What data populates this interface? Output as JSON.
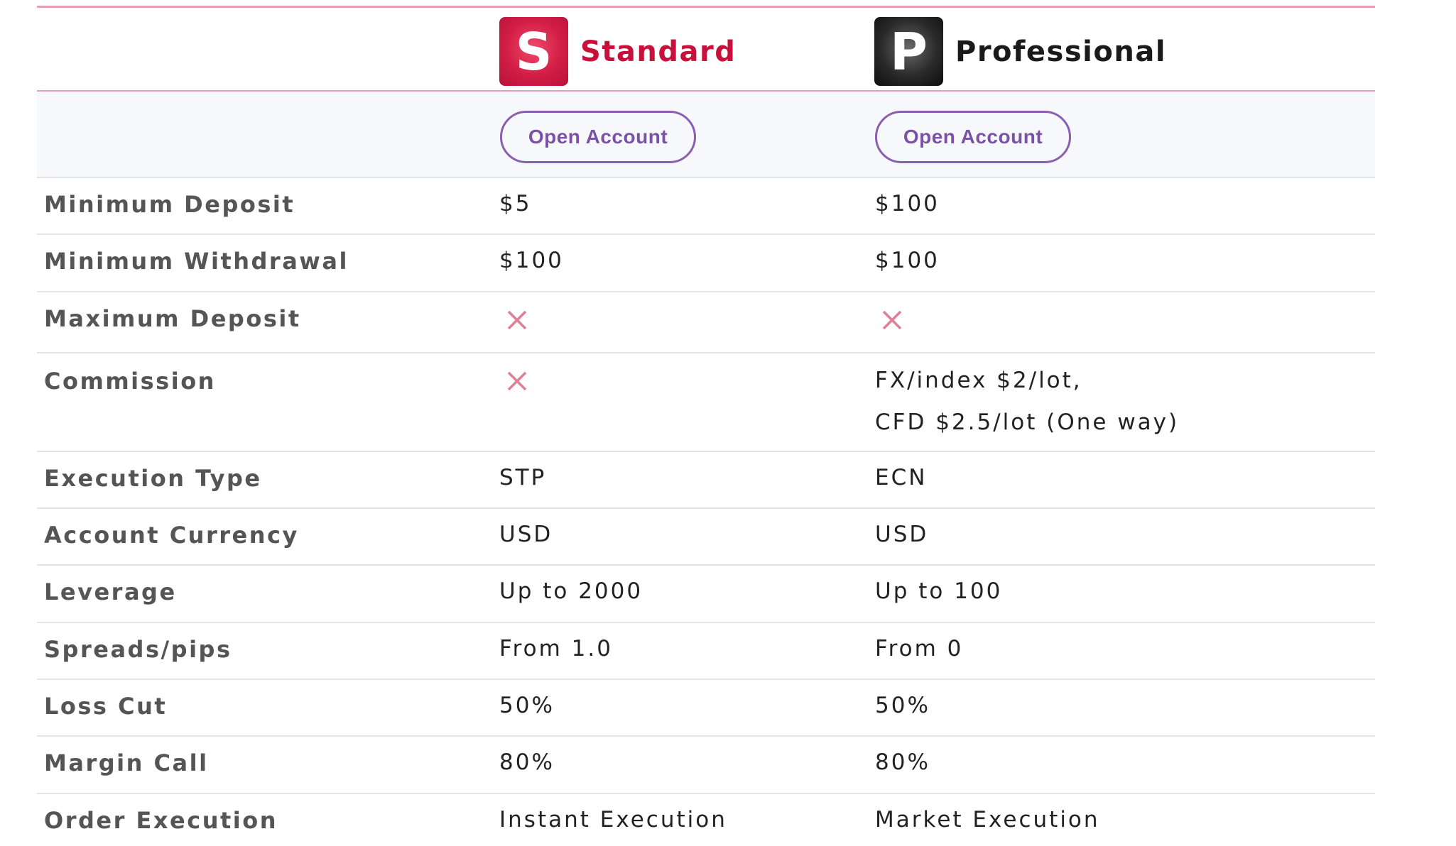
{
  "plans": [
    {
      "letter": "S",
      "name": "Standard",
      "button": "Open Account"
    },
    {
      "letter": "P",
      "name": "Professional",
      "button": "Open Account"
    }
  ],
  "rows": [
    {
      "label": "Minimum Deposit",
      "standard": "$5",
      "professional": "$100"
    },
    {
      "label": "Minimum Withdrawal",
      "standard": "$100",
      "professional": "$100"
    },
    {
      "label": "Maximum Deposit",
      "standard": "",
      "professional": ""
    },
    {
      "label": "Commission",
      "standard": "",
      "professional_line1": "FX/index $2/lot,",
      "professional_line2": "CFD $2.5/lot (One way)"
    },
    {
      "label": "Execution Type",
      "standard": "STP",
      "professional": "ECN"
    },
    {
      "label": "Account Currency",
      "standard": "USD",
      "professional": "USD"
    },
    {
      "label": "Leverage",
      "standard": "Up to 2000",
      "professional": "Up to 100"
    },
    {
      "label": "Spreads/pips",
      "standard": "From 1.0",
      "professional": "From 0"
    },
    {
      "label": "Loss Cut",
      "standard": "50%",
      "professional": "50%"
    },
    {
      "label": "Margin Call",
      "standard": "80%",
      "professional": "80%"
    },
    {
      "label": "Order Execution",
      "standard": "Instant Execution",
      "professional": "Market Execution"
    }
  ],
  "icons": {
    "not_available": "x-mark-icon"
  },
  "colors": {
    "standard_brand": "#c8103a",
    "professional_brand": "#1a1a1a",
    "button_outline": "#8a5fb0",
    "x_mark": "#e07f98",
    "header_rule": "#e3a0b0"
  }
}
